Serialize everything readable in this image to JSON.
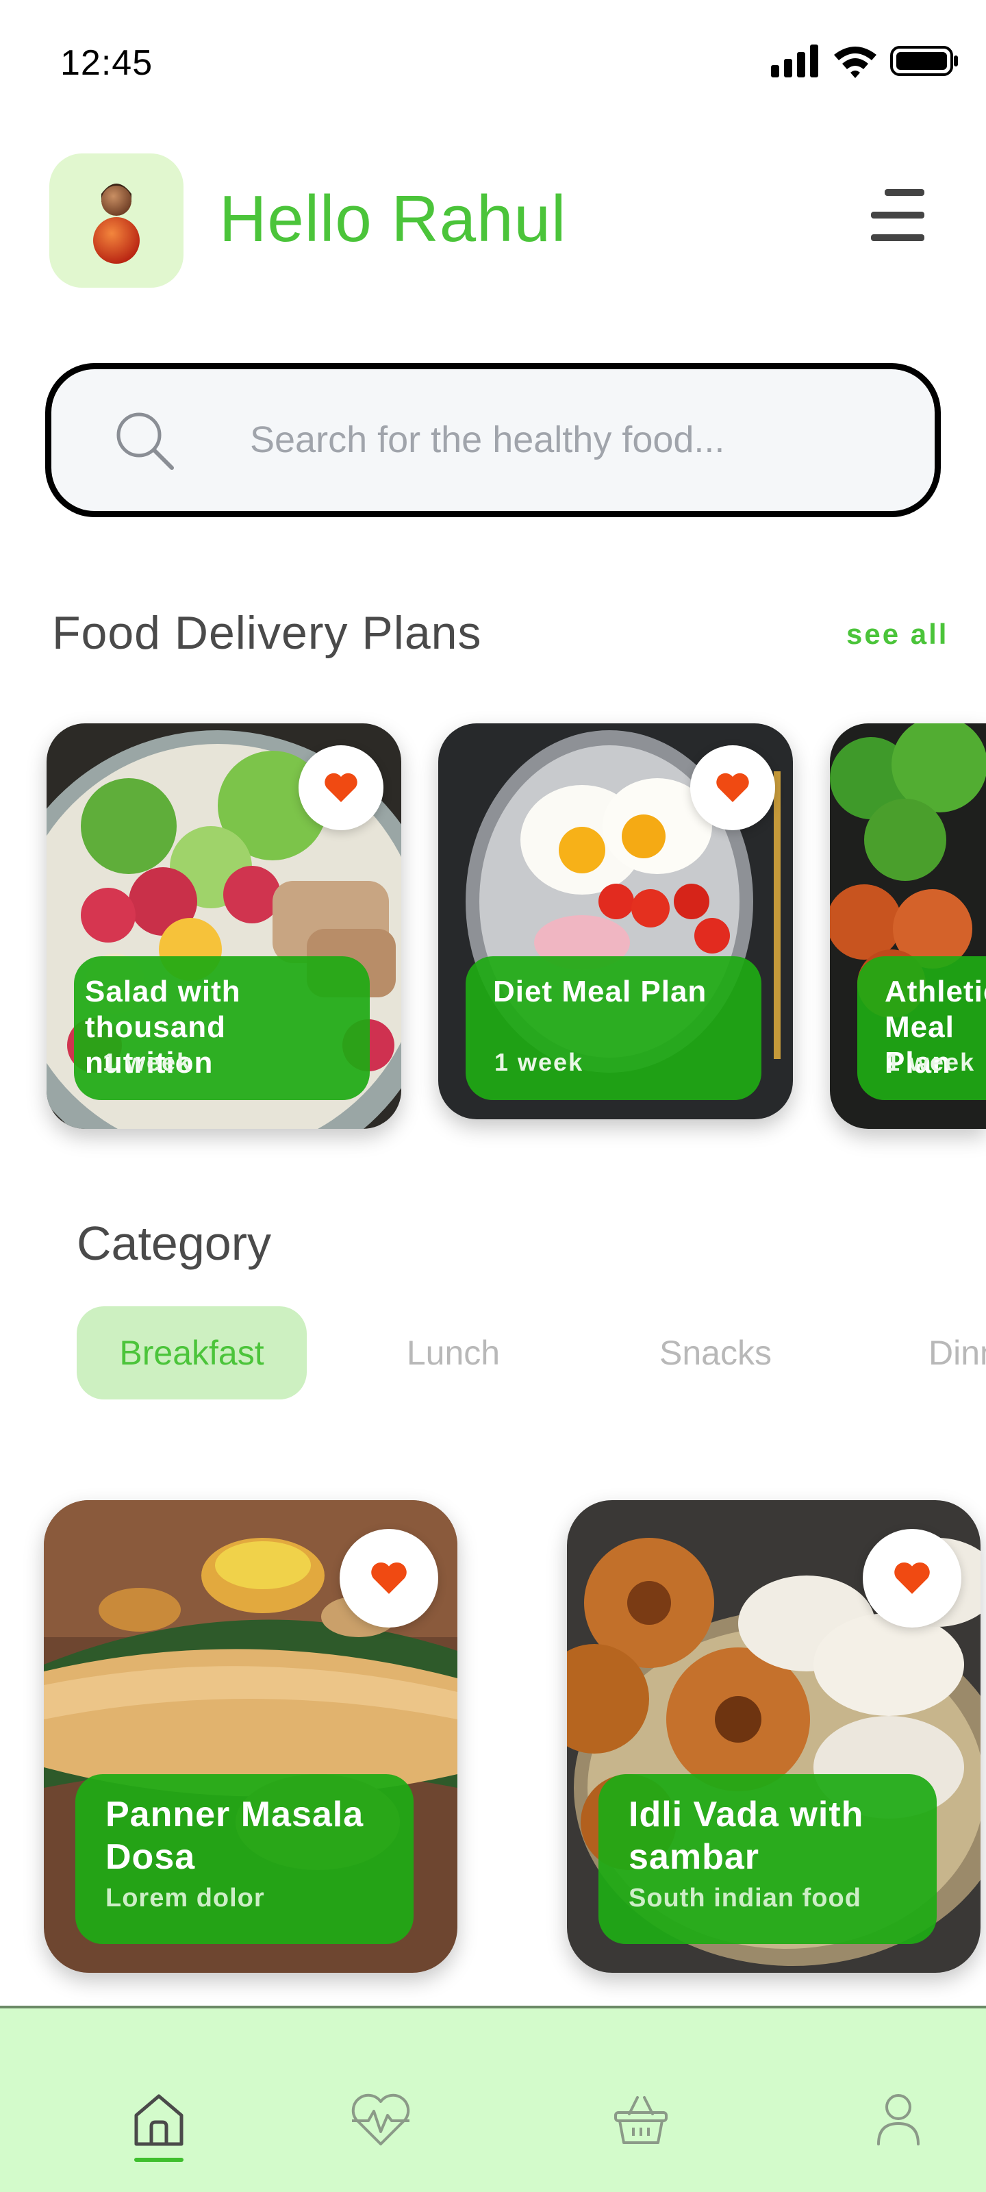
{
  "status_bar": {
    "time": "12:45"
  },
  "header": {
    "greeting": "Hello Rahul"
  },
  "search": {
    "placeholder": "Search for the healthy food..."
  },
  "plans_section": {
    "title": "Food Delivery Plans",
    "see_all": "see all",
    "cards": [
      {
        "title": "Salad with thousand nutrition",
        "duration": "1 week"
      },
      {
        "title": "Diet Meal Plan",
        "duration": "1 week"
      },
      {
        "title": "Athletic Meal Plan",
        "duration": "1 week"
      }
    ]
  },
  "category": {
    "title": "Category",
    "tabs": [
      "Breakfast",
      "Lunch",
      "Snacks",
      "Dinner"
    ],
    "active_tab": "Breakfast"
  },
  "foods": [
    {
      "title": "Panner Masala Dosa",
      "subtitle": "Lorem dolor"
    },
    {
      "title": "Idli Vada with sambar",
      "subtitle": "South indian food"
    }
  ],
  "bottom_nav": {
    "items": [
      "home-icon",
      "health-icon",
      "basket-icon",
      "profile-icon"
    ],
    "active": "home-icon"
  },
  "colors": {
    "brand_green": "#4bc43a",
    "card_label_green": "#1eaa14",
    "favorite_heart": "#f04a12",
    "nav_background": "#d3fbcb",
    "active_tab_bg": "#cdf0c1"
  }
}
